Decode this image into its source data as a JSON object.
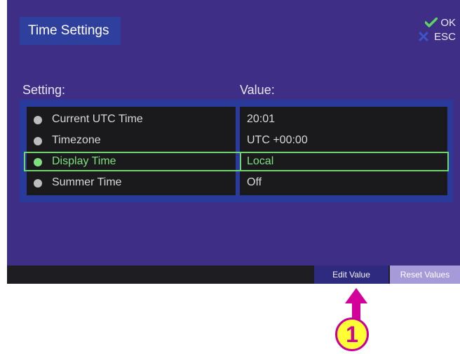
{
  "title": "Time Settings",
  "keys": {
    "ok": "OK",
    "esc": "ESC"
  },
  "columns": {
    "setting": "Setting:",
    "value": "Value:"
  },
  "rows": [
    {
      "label": "Current UTC Time",
      "value": "20:01"
    },
    {
      "label": "Timezone",
      "value": "UTC +00:00"
    },
    {
      "label": "Display Time",
      "value": "Local"
    },
    {
      "label": "Summer Time",
      "value": "Off"
    }
  ],
  "buttons": {
    "edit": "Edit Value",
    "reset": "Reset Values"
  },
  "callout": "1",
  "colors": {
    "accent": "#6fd66f",
    "screen_bg": "#3f2e86",
    "callout_fill": "#ffff33",
    "callout_stroke": "#c8009b"
  }
}
